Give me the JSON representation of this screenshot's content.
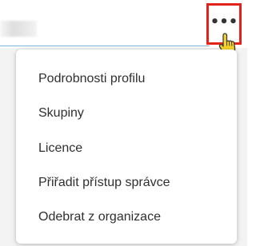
{
  "more_button": {
    "label": "•••",
    "icon": "more-horizontal-icon",
    "highlight_color": "#e2231a"
  },
  "cursor": {
    "icon": "hand-pointer-icon"
  },
  "menu": {
    "items": [
      {
        "label": "Podrobnosti profilu"
      },
      {
        "label": "Skupiny"
      },
      {
        "label": "Licence"
      },
      {
        "label": "Přiřadit přístup správce"
      },
      {
        "label": "Odebrat z organizace"
      }
    ]
  }
}
